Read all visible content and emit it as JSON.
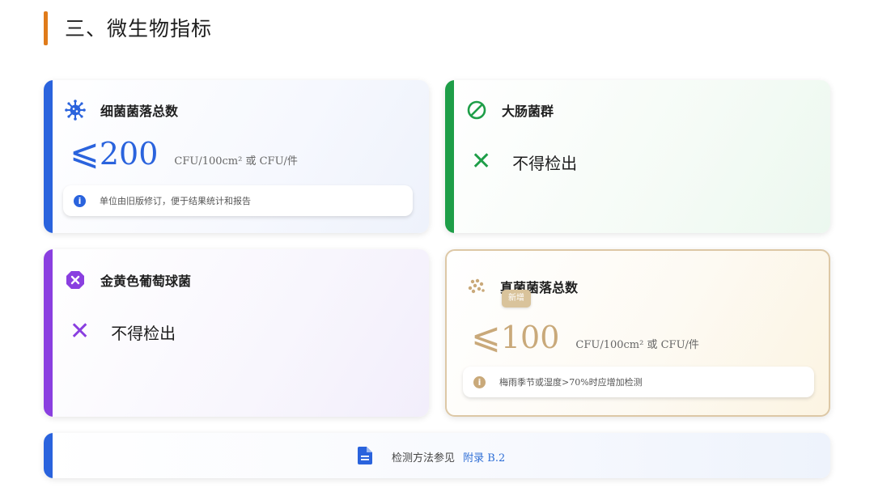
{
  "page": {
    "title": "三、微生物指标"
  },
  "colors": {
    "blue": "#2a63dd",
    "green": "#1e9e48",
    "purple": "#8a3fe0",
    "gold": "#c9a97a",
    "title_accent": "#e07b1a"
  },
  "cards": {
    "bacteria": {
      "name": "细菌菌落总数",
      "icon": "virus-icon",
      "symbol": "⩽",
      "value": "200",
      "unit": "CFU/100cm²  或 CFU/件",
      "note": "单位由旧版修订，便于结果统计和报告"
    },
    "coliform": {
      "name": "大肠菌群",
      "icon": "prohibited-icon",
      "result": "不得检出"
    },
    "staph": {
      "name": "金黄色葡萄球菌",
      "icon": "octagon-x-icon",
      "result": "不得检出"
    },
    "fungi": {
      "name": "真菌菌落总数",
      "icon": "dots-icon",
      "badge": "新增",
      "symbol": "⩽",
      "value": "100",
      "unit": "CFU/100cm²  或 CFU/件",
      "note": "梅雨季节或湿度>70%时应增加检测"
    }
  },
  "footer": {
    "text": "检测方法参见",
    "link": "附录 B.2",
    "icon": "document-icon"
  }
}
